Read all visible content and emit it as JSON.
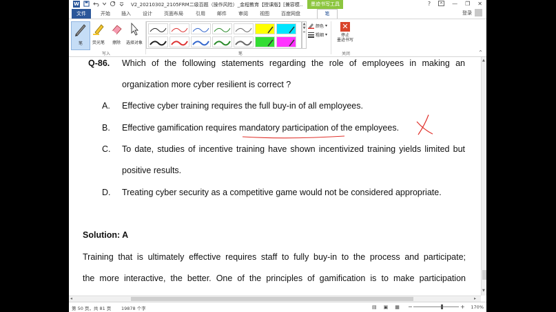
{
  "titlebar": {
    "app_icon": "W",
    "title": "V2_20210302_2105FRM二级百题（操作风险）_金程教育【授课版】[兼容模...",
    "context_tab_title": "墨迹书写工具",
    "help": "?",
    "minimize": "—",
    "restore": "❐",
    "close": "✕"
  },
  "tabs": {
    "file": "文件",
    "items": [
      "开始",
      "插入",
      "设计",
      "页面布局",
      "引用",
      "邮件",
      "审阅",
      "视图",
      "百度网盘"
    ],
    "pen": "笔",
    "login": "登录"
  },
  "ribbon": {
    "write_group": {
      "label": "写入",
      "pen": "笔",
      "highlighter": "荧光笔",
      "eraser": "擦除",
      "select_objects": "选择对象"
    },
    "pens_group": {
      "label": "笔",
      "color": "颜色",
      "weight": "粗细"
    },
    "close_group": {
      "label": "关闭",
      "stop_line1": "停止",
      "stop_line2": "墨迹书写"
    }
  },
  "document": {
    "question_number": "Q-86.",
    "question_line1": "Which of the following statements regarding the role of employees in making an",
    "question_line2": "organization more cyber resilient is correct ?",
    "options": [
      {
        "letter": "A.",
        "line1": "Effective cyber training requires the full buy-in of all employees.",
        "line2": ""
      },
      {
        "letter": "B.",
        "line1": "Effective gamification requires mandatory participation of the employees.",
        "line2": ""
      },
      {
        "letter": "C.",
        "line1": "To date, studies of incentive training have shown incentivized training yields limited but",
        "line2": "positive results."
      },
      {
        "letter": "D.",
        "line1": "Treating cyber security as a competitive game would not be considered appropriate.",
        "line2": ""
      }
    ],
    "solution": "Solution: A",
    "explanation_line1": "Training that is ultimately effective requires staff to fully buy-in to the process and participate;",
    "explanation_line2": "the more interactive, the better. One of the principles of gamification is to make participation"
  },
  "status": {
    "page": "第 50 页，共 81 页",
    "words": "19878 个字",
    "zoom": "170%"
  },
  "colors": {
    "file_tab": "#2b579a",
    "context_tab": "#8cc63f",
    "ink_red": "#e0302a"
  }
}
